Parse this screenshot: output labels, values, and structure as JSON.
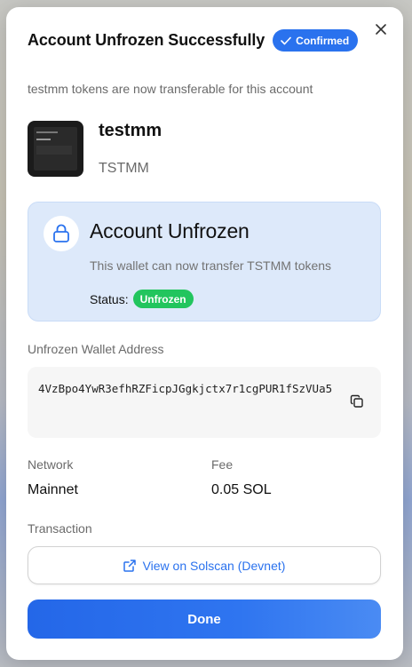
{
  "modal": {
    "title": "Account Unfrozen Successfully",
    "confirmed_badge": "Confirmed",
    "subtitle": "testmm tokens are now transferable for this account",
    "close_icon": "close-icon"
  },
  "token": {
    "name": "testmm",
    "symbol": "TSTMM"
  },
  "status_card": {
    "icon": "lock-icon",
    "title": "Account Unfrozen",
    "description": "This wallet can now transfer TSTMM tokens",
    "status_label": "Status:",
    "status_value": "Unfrozen"
  },
  "address": {
    "label": "Unfrozen Wallet Address",
    "value": "4VzBpo4YwR3efhRZFicpJGgkjctx7r1cgPUR1fSzVUa5",
    "copy_icon": "copy-icon"
  },
  "details": {
    "network_label": "Network",
    "network_value": "Mainnet",
    "fee_label": "Fee",
    "fee_value": "0.05 SOL"
  },
  "transaction": {
    "label": "Transaction",
    "link_label": "View on Solscan (Devnet)",
    "link_icon": "external-link-icon"
  },
  "actions": {
    "done_label": "Done"
  },
  "colors": {
    "primary": "#2a72ee",
    "success": "#22c55e",
    "status_card_bg": "#dde9fa"
  }
}
